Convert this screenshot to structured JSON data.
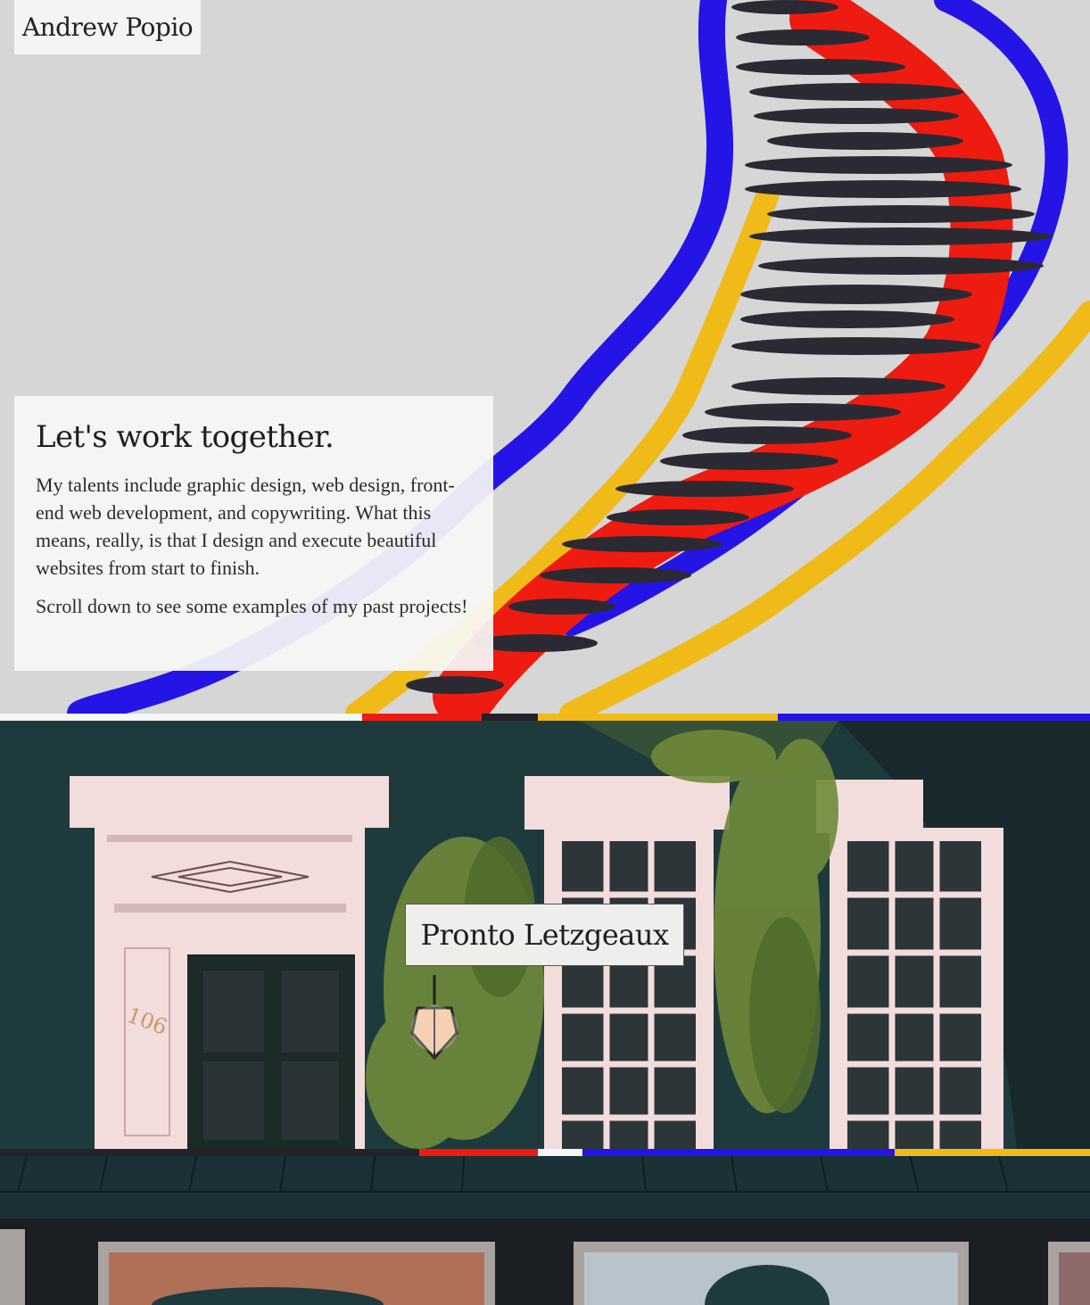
{
  "header": {
    "brand": "Andrew Popio"
  },
  "intro": {
    "heading": "Let's work together.",
    "paragraph_1": "My talents include graphic design, web design, front-end web development, and copywriting. What this means, really, is that I design and execute beautiful websites from start to finish.",
    "paragraph_2": "Scroll down to see some examples of my past projects!"
  },
  "projects": [
    {
      "title": "Pronto Letzgeaux"
    }
  ],
  "house_number": "106",
  "colors": {
    "hero_bg": "#d6d6d6",
    "blue": "#2415e6",
    "red": "#ee1b10",
    "yellow": "#f0bb18",
    "charcoal": "#2b2a33",
    "house_wall": "#1f3a3d",
    "trim_pink": "#f3dcdc",
    "ivy": "#6f8a3a"
  },
  "icons": [
    "lantern-icon"
  ]
}
